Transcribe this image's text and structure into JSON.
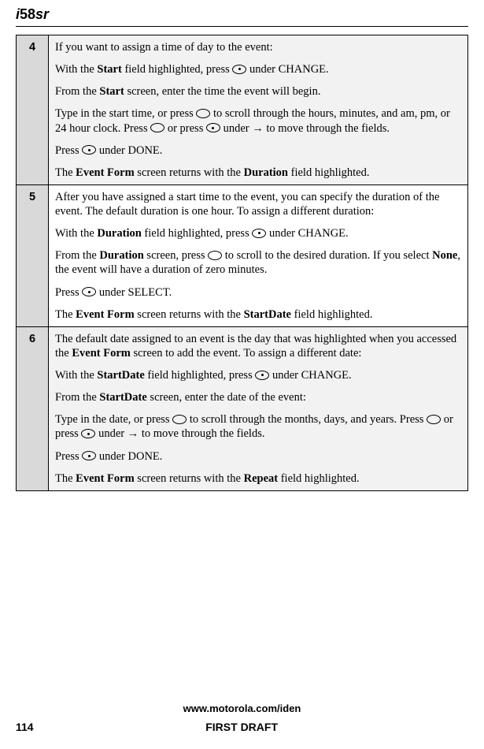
{
  "header": {
    "model_prefix": "i",
    "model_number": "58",
    "model_suffix": "sr"
  },
  "steps": [
    {
      "num": "4",
      "shaded": true,
      "paragraphs": [
        {
          "parts": [
            {
              "t": "If you want to assign a time of day to the event:"
            }
          ]
        },
        {
          "parts": [
            {
              "t": "With the "
            },
            {
              "b": true,
              "t": "Start"
            },
            {
              "t": " field highlighted, press "
            },
            {
              "icon": "oval-dot"
            },
            {
              "t": " under CHANGE."
            }
          ]
        },
        {
          "parts": [
            {
              "t": "From the "
            },
            {
              "b": true,
              "t": "Start"
            },
            {
              "t": " screen, enter the time the event will begin."
            }
          ]
        },
        {
          "parts": [
            {
              "t": "Type in the start time, or press "
            },
            {
              "icon": "oval"
            },
            {
              "t": " to scroll through the hours, minutes, and am, pm, or 24 hour clock. Press "
            },
            {
              "icon": "oval"
            },
            {
              "t": " or press "
            },
            {
              "icon": "oval-dot"
            },
            {
              "t": " under  "
            },
            {
              "arrow": true
            },
            {
              "t": " to move through the fields."
            }
          ]
        },
        {
          "parts": [
            {
              "t": "Press "
            },
            {
              "icon": "oval-dot"
            },
            {
              "t": " under DONE."
            }
          ]
        },
        {
          "parts": [
            {
              "t": "The "
            },
            {
              "b": true,
              "t": "Event Form"
            },
            {
              "t": " screen returns with the "
            },
            {
              "b": true,
              "t": "Duration"
            },
            {
              "t": " field highlighted."
            }
          ]
        }
      ]
    },
    {
      "num": "5",
      "shaded": false,
      "paragraphs": [
        {
          "parts": [
            {
              "t": "After you have assigned a start time to the event, you can specify the duration of the event. The default duration is one hour. To assign a different duration:"
            }
          ]
        },
        {
          "parts": [
            {
              "t": "With the "
            },
            {
              "b": true,
              "t": "Duration"
            },
            {
              "t": " field highlighted, press "
            },
            {
              "icon": "oval-dot"
            },
            {
              "t": " under CHANGE."
            }
          ]
        },
        {
          "parts": [
            {
              "t": "From the "
            },
            {
              "b": true,
              "t": "Duration"
            },
            {
              "t": " screen, press "
            },
            {
              "icon": "oval"
            },
            {
              "t": " to scroll to the desired duration. If you select "
            },
            {
              "b": true,
              "t": "None"
            },
            {
              "t": ", the event will have a duration of zero minutes."
            }
          ]
        },
        {
          "parts": [
            {
              "t": "Press "
            },
            {
              "icon": "oval-dot"
            },
            {
              "t": " under SELECT."
            }
          ]
        },
        {
          "parts": [
            {
              "t": "The "
            },
            {
              "b": true,
              "t": "Event Form"
            },
            {
              "t": " screen returns with the "
            },
            {
              "b": true,
              "t": "StartDate"
            },
            {
              "t": " field highlighted."
            }
          ]
        }
      ]
    },
    {
      "num": "6",
      "shaded": true,
      "paragraphs": [
        {
          "parts": [
            {
              "t": "The default date assigned to an event is the day that was highlighted when you accessed the "
            },
            {
              "b": true,
              "t": "Event Form"
            },
            {
              "t": " screen to add the event. To assign a different date:"
            }
          ]
        },
        {
          "parts": [
            {
              "t": "With the "
            },
            {
              "b": true,
              "t": "StartDate"
            },
            {
              "t": " field highlighted, press "
            },
            {
              "icon": "oval-dot"
            },
            {
              "t": " under CHANGE."
            }
          ]
        },
        {
          "parts": [
            {
              "t": "From the "
            },
            {
              "b": true,
              "t": "StartDate"
            },
            {
              "t": " screen, enter the date of the event:"
            }
          ]
        },
        {
          "parts": [
            {
              "t": "Type in the date, or press "
            },
            {
              "icon": "oval"
            },
            {
              "t": " to scroll through the months, days, and years. Press "
            },
            {
              "icon": "oval"
            },
            {
              "t": " or press "
            },
            {
              "icon": "oval-dot"
            },
            {
              "t": " under  "
            },
            {
              "arrow": true
            },
            {
              "t": " to move through the fields."
            }
          ]
        },
        {
          "parts": [
            {
              "t": "Press "
            },
            {
              "icon": "oval-dot"
            },
            {
              "t": " under DONE."
            }
          ]
        },
        {
          "parts": [
            {
              "t": "The "
            },
            {
              "b": true,
              "t": "Event Form"
            },
            {
              "t": " screen returns with the "
            },
            {
              "b": true,
              "t": "Repeat"
            },
            {
              "t": " field highlighted."
            }
          ]
        }
      ]
    }
  ],
  "footer": {
    "url": "www.motorola.com/iden",
    "page_number": "114",
    "draft_label": "FIRST DRAFT"
  }
}
